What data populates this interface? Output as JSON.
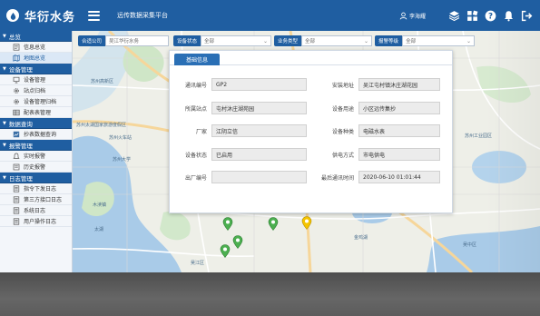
{
  "brand": {
    "name": "华衍水务"
  },
  "header": {
    "title": "远传数据采集平台",
    "user_name": "李海耀",
    "colors": {
      "primary": "#1f5ea1",
      "accent": "#2a6fb5"
    }
  },
  "sidebar": {
    "sections": [
      {
        "title": "总览",
        "items": [
          {
            "label": "信息总览",
            "icon": "doc-icon"
          },
          {
            "label": "地图总览",
            "icon": "map-icon",
            "active": true
          }
        ]
      },
      {
        "title": "设备管理",
        "items": [
          {
            "label": "设备管理",
            "icon": "device-icon"
          },
          {
            "label": "站点归档",
            "icon": "gear-icon"
          },
          {
            "label": "设备管理归档",
            "icon": "gear-icon"
          },
          {
            "label": "配表表管理",
            "icon": "table-icon"
          }
        ]
      },
      {
        "title": "数据查询",
        "items": [
          {
            "label": "抄表数据查询",
            "icon": "chart-icon"
          }
        ]
      },
      {
        "title": "报警管理",
        "items": [
          {
            "label": "实时报警",
            "icon": "alarm-icon"
          },
          {
            "label": "历史报警",
            "icon": "history-icon"
          }
        ]
      },
      {
        "title": "日志管理",
        "items": [
          {
            "label": "指令下发日志",
            "icon": "log-icon"
          },
          {
            "label": "第三方接口日志",
            "icon": "log-icon"
          },
          {
            "label": "系统日志",
            "icon": "log-icon"
          },
          {
            "label": "用户操作日志",
            "icon": "log-icon"
          }
        ]
      }
    ]
  },
  "filters": [
    {
      "label": "合适公司",
      "value": "吴江华衍水务"
    },
    {
      "label": "设备状态",
      "value": "全部"
    },
    {
      "label": "业务类型",
      "value": "全部"
    },
    {
      "label": "报警等级",
      "value": "全部"
    }
  ],
  "panel": {
    "tab": "基础信息",
    "fields_left": [
      {
        "label": "通讯编号",
        "value": "GP2"
      },
      {
        "label": "所属站点",
        "value": "屯村沐庄湖苑园"
      },
      {
        "label": "厂家",
        "value": "江阴立信"
      },
      {
        "label": "设备状态",
        "value": "已启用"
      },
      {
        "label": "出厂编号",
        "value": ""
      }
    ],
    "fields_right": [
      {
        "label": "安装地址",
        "value": "吴江屯村镇沐庄湖花园"
      },
      {
        "label": "设备用途",
        "value": "小区远传集抄"
      },
      {
        "label": "设备种类",
        "value": "电磁水表"
      },
      {
        "label": "供电方式",
        "value": "市电供电"
      },
      {
        "label": "最后通讯时间",
        "value": "2020-06-10 01:01:44"
      }
    ]
  },
  "map_labels": [
    "苏州高新区",
    "吴中区",
    "苏州工业园区",
    "苏州太湖国家旅游度假区",
    "吴江区",
    "太湖",
    "苏州大学",
    "苏州火车站",
    "木渎镇",
    "金鸡湖"
  ]
}
